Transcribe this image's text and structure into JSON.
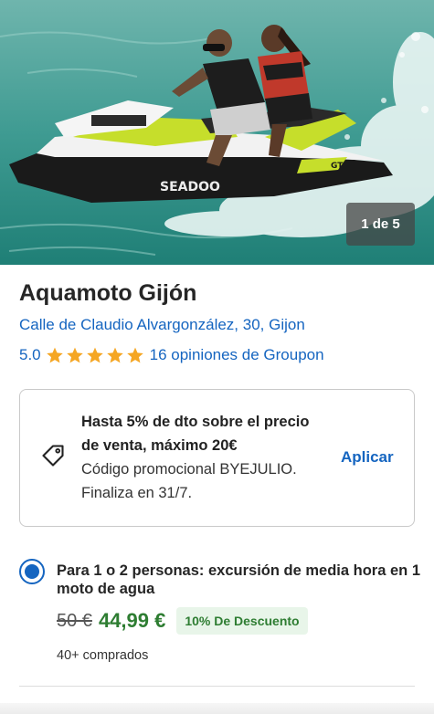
{
  "gallery": {
    "counter": "1 de 5",
    "brand_on_hull": "SEADOO",
    "model_on_hull": "GTI"
  },
  "listing": {
    "title": "Aquamoto Gijón",
    "address": "Calle de Claudio Alvargonzález, 30, Gijon",
    "rating": "5.0",
    "stars": 5,
    "reviews": "16 opiniones de Groupon"
  },
  "promo": {
    "headline_line1": "Hasta 5% de dto sobre el precio",
    "headline_line2": "de venta, máximo 20€",
    "code_text": "Código promocional BYEJULIO.",
    "ends_text": "Finaliza en 31/7.",
    "apply_label": "Aplicar",
    "icon": "tag-icon"
  },
  "option": {
    "selected": true,
    "title": "Para 1 o 2 personas: excursión de media hora en 1 moto de agua",
    "old_price": "50 €",
    "new_price": "44,99 €",
    "discount": "10% De Descuento",
    "bought": "40+ comprados"
  },
  "colors": {
    "link": "#1565c0",
    "star": "#f5a623",
    "price": "#2e7d32",
    "discount_bg": "#e8f5e9"
  }
}
